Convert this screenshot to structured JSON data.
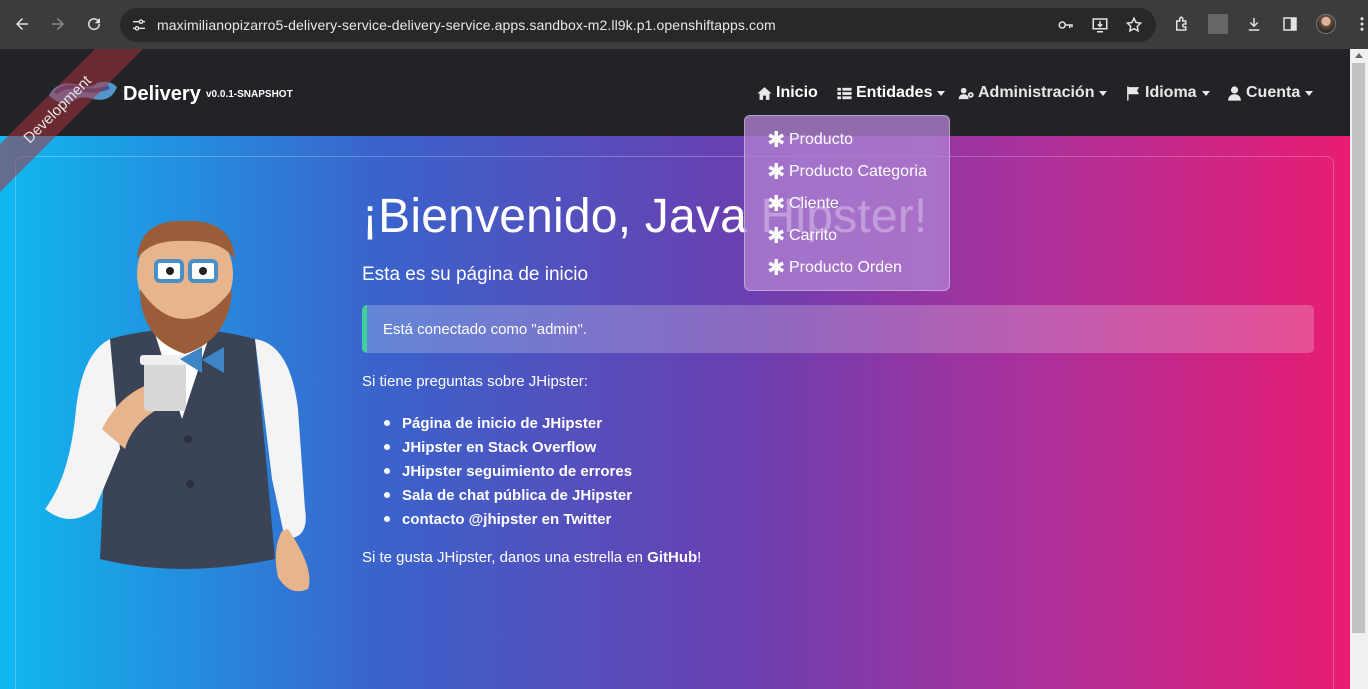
{
  "browser": {
    "url": "maximilianopizarro5-delivery-service-delivery-service.apps.sandbox-m2.ll9k.p1.openshiftapps.com"
  },
  "ribbon": {
    "label": "Development"
  },
  "brand": {
    "title": "Delivery",
    "version": "v0.0.1-SNAPSHOT"
  },
  "nav": {
    "home": "Inicio",
    "entities": "Entidades",
    "admin": "Administración",
    "language": "Idioma",
    "account": "Cuenta"
  },
  "entities_menu": {
    "items": [
      "Producto",
      "Producto Categoria",
      "Cliente",
      "Carrito",
      "Producto Orden"
    ]
  },
  "main": {
    "welcome": "¡Bienvenido, Java Hipster!",
    "subtitle": "Esta es su página de inicio",
    "alert": "Está conectado como \"admin\".",
    "questions": "Si tiene preguntas sobre JHipster:",
    "links": [
      "Página de inicio de JHipster",
      "JHipster en Stack Overflow",
      "JHipster seguimiento de errores",
      "Sala de chat pública de JHipster",
      "contacto @jhipster en Twitter"
    ],
    "github_prefix": "Si te gusta JHipster, danos una estrella en ",
    "github_link": "GitHub",
    "github_suffix": "!"
  },
  "colors": {
    "gradient_left": "#0fb8f0",
    "gradient_right": "#e81c72",
    "navbar": "#222326",
    "alert_border": "#3fd19c"
  }
}
